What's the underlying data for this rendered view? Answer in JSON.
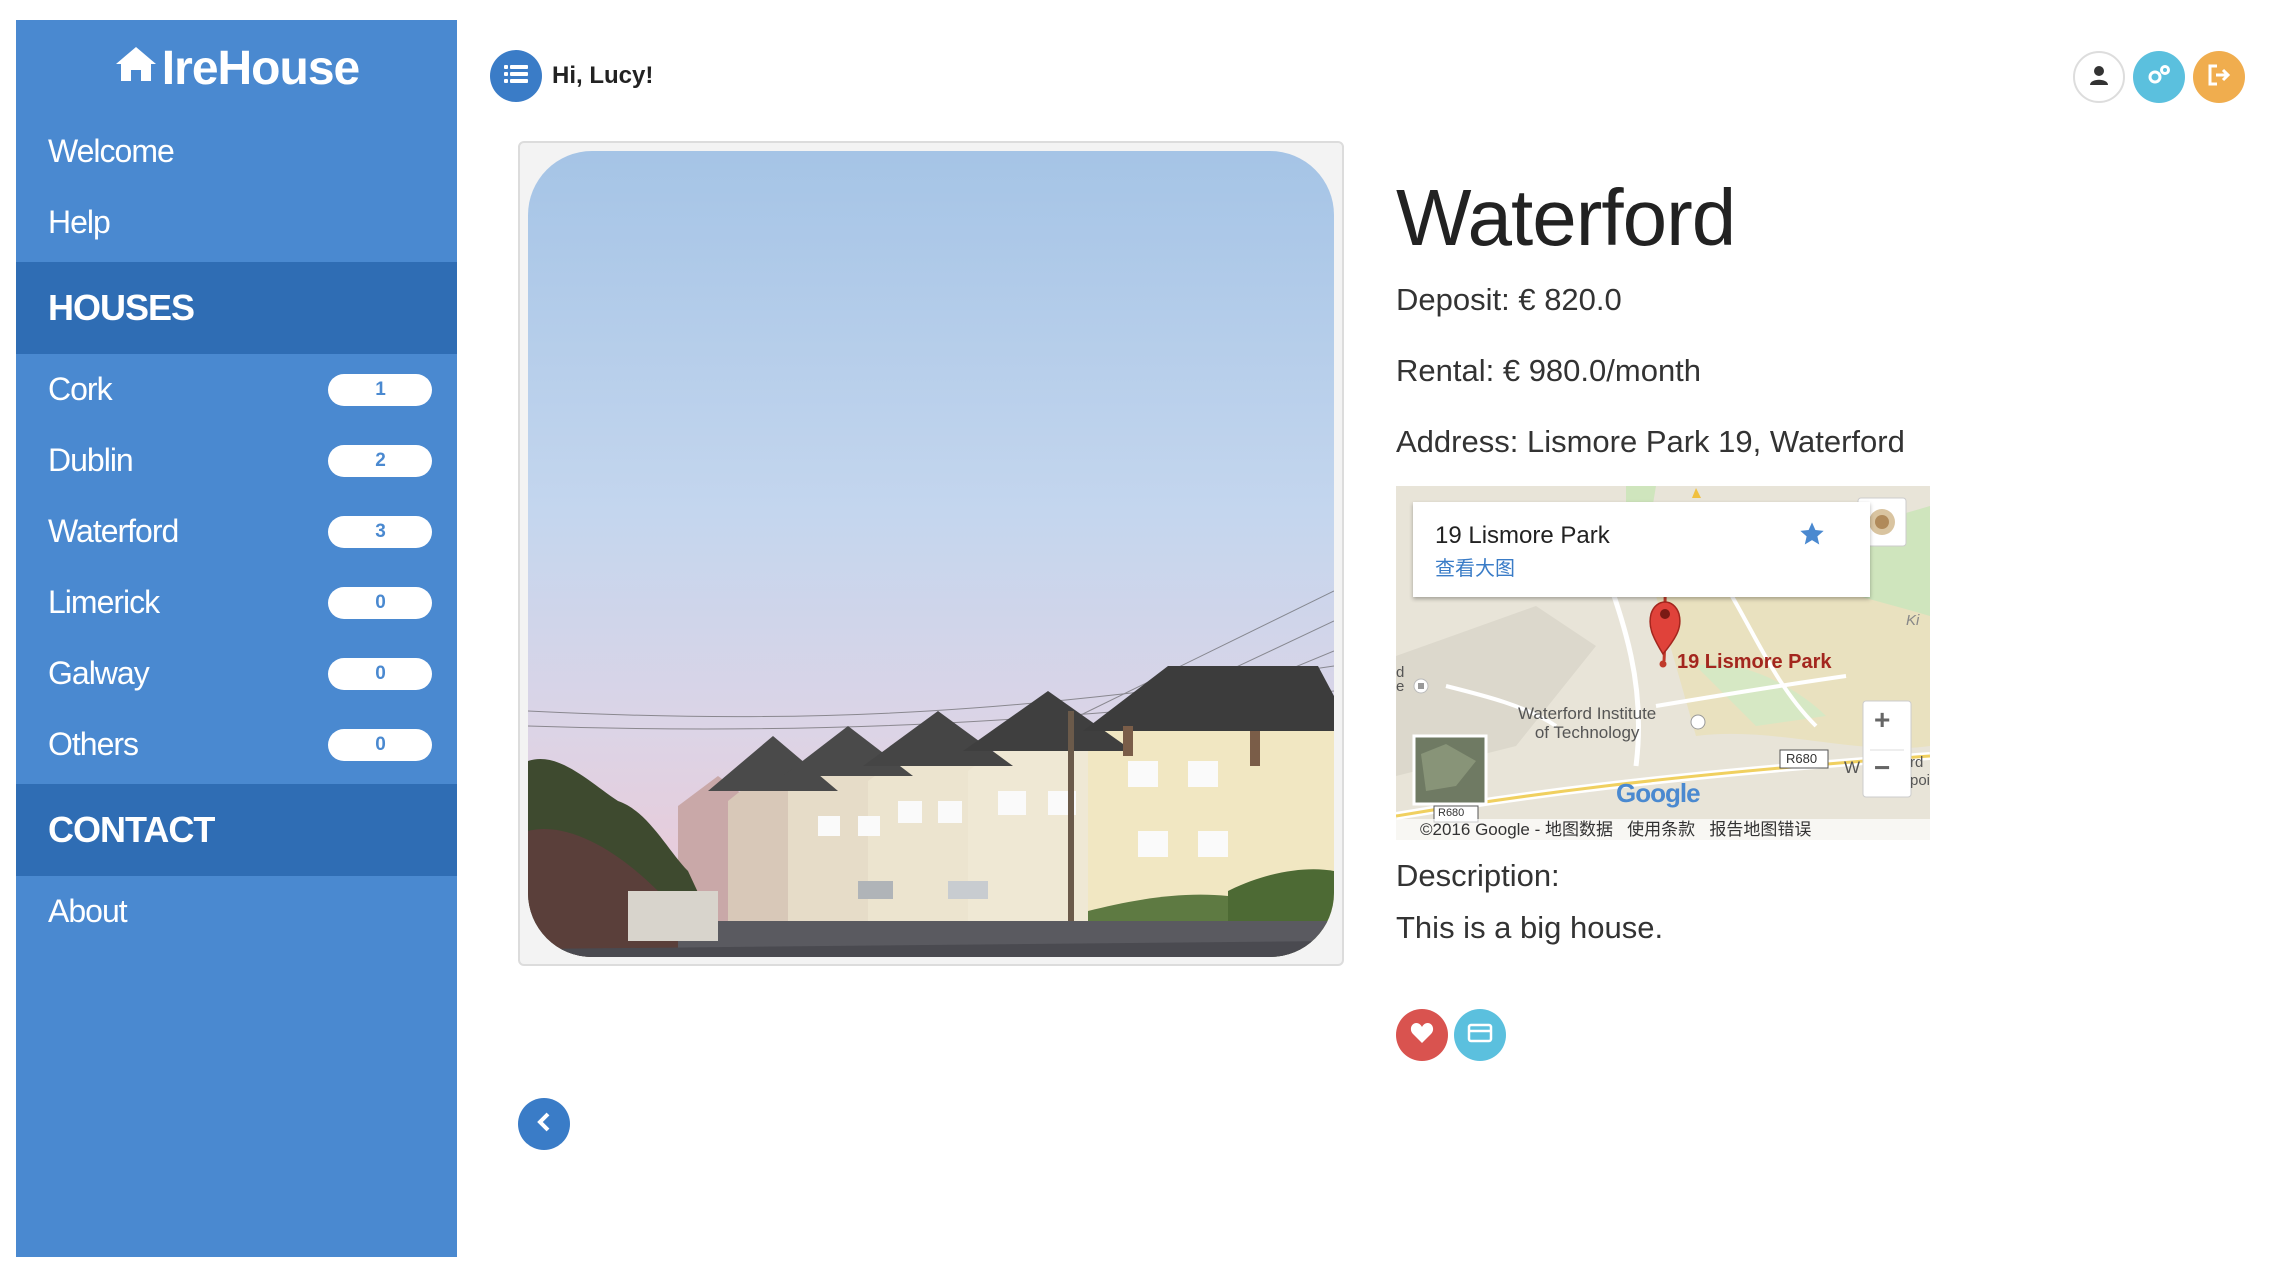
{
  "brand": {
    "name": "IreHouse",
    "icon": "home-icon"
  },
  "sidebar": {
    "top_links": [
      {
        "label": "Welcome"
      },
      {
        "label": "Help"
      }
    ],
    "houses_header": "HOUSES",
    "cities": [
      {
        "label": "Cork",
        "count": "1"
      },
      {
        "label": "Dublin",
        "count": "2"
      },
      {
        "label": "Waterford",
        "count": "3"
      },
      {
        "label": "Limerick",
        "count": "0"
      },
      {
        "label": "Galway",
        "count": "0"
      },
      {
        "label": "Others",
        "count": "0"
      }
    ],
    "contact_header": "CONTACT",
    "contact_links": [
      {
        "label": "About"
      }
    ]
  },
  "topbar": {
    "greeting": "Hi, Lucy!",
    "menu_icon": "list-icon",
    "right_icons": [
      "user-icon",
      "settings-icon",
      "logout-icon"
    ]
  },
  "house": {
    "city": "Waterford",
    "deposit": "Deposit: € 820.0",
    "rental": "Rental: € 980.0/month",
    "address": "Address: Lismore Park 19, Waterford",
    "description_label": "Description:",
    "description": "This is a big house."
  },
  "map": {
    "card_title": "19 Lismore Park",
    "card_link": "查看大图",
    "marker_label": "19 Lismore Park",
    "institute": "Waterford Institute",
    "institute2": "of Technology",
    "road": "R680",
    "road2": "R680",
    "google": "Google",
    "footer": "©2016 Google - 地图数据   使用条款   报告地图错误",
    "zoom_in": "+",
    "zoom_out": "−",
    "frag_d": "d",
    "frag_e": "e",
    "frag_w": "W",
    "frag_rd": "rd",
    "frag_poi": "poi",
    "frag_ki": "Ki"
  },
  "actions": {
    "favorite_icon": "heart-icon",
    "payment_icon": "credit-card-icon",
    "back_icon": "chevron-left-icon"
  },
  "colors": {
    "sidebar": "#4a89d0",
    "sidebar_section": "#2f6db4",
    "info": "#5bc0de",
    "warning": "#f0ad4e",
    "danger": "#d9534f",
    "primary": "#3a7cc7"
  }
}
